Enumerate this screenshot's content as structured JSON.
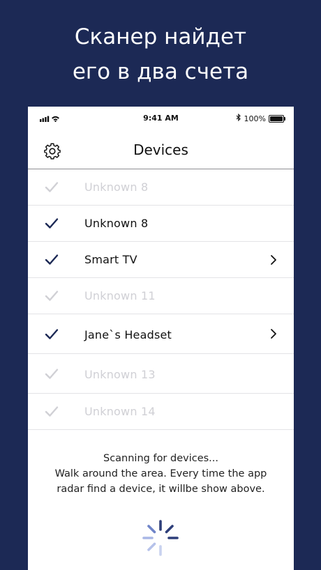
{
  "headline": {
    "line1": "Сканер найдет",
    "line2": "его в два счета"
  },
  "status_bar": {
    "time": "9:41 AM",
    "battery": "100%"
  },
  "nav": {
    "title": "Devices"
  },
  "devices": [
    {
      "name": "Unknown 8",
      "active": false,
      "has_detail": false
    },
    {
      "name": "Unknown 8",
      "active": true,
      "has_detail": false
    },
    {
      "name": "Smart TV",
      "active": true,
      "has_detail": true
    },
    {
      "name": "Unknown 11",
      "active": false,
      "has_detail": false
    },
    {
      "name": "Jane`s Headset",
      "active": true,
      "has_detail": true
    },
    {
      "name": "Unknown 13",
      "active": false,
      "has_detail": false
    },
    {
      "name": "Unknown 14",
      "active": false,
      "has_detail": false
    }
  ],
  "scan": {
    "line1": "Scanning for devices...",
    "line2": "Walk around the area. Every time the app",
    "line3": "radar find a device, it willbe show above."
  },
  "colors": {
    "background": "#1c2955",
    "check_active": "#1c2955",
    "check_inactive": "#d0d0d5",
    "spinner_dark": "#2e3f7a",
    "spinner_light": "#a9b7e6"
  },
  "icons": {
    "settings": "gear-icon",
    "check": "checkmark-icon",
    "detail": "chevron-right-icon",
    "loading": "spinner-icon"
  }
}
